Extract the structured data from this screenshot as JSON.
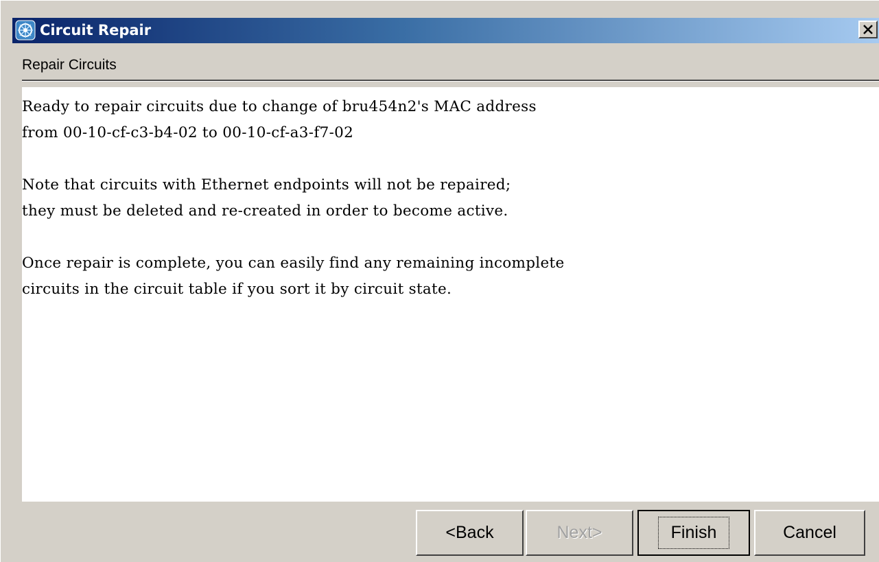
{
  "window": {
    "title": "Circuit Repair",
    "icon": "circuit-app-icon",
    "close_icon": "close-icon"
  },
  "header": {
    "label": "Repair Circuits"
  },
  "content": {
    "lines": [
      "Ready to repair circuits due to change of bru454n2's MAC address",
      "from 00-10-cf-c3-b4-02 to 00-10-cf-a3-f7-02",
      "",
      "Note that circuits with Ethernet endpoints will not be repaired;",
      "they must be deleted and re-created in order to become active.",
      "",
      "Once repair is complete, you can easily find any remaining incomplete",
      "circuits in the circuit table if you sort it by circuit state."
    ]
  },
  "buttons": {
    "back": "<Back",
    "next": "Next>",
    "finish": "Finish",
    "cancel": "Cancel"
  },
  "colors": {
    "titlebar_start": "#0a246a",
    "titlebar_end": "#a6caf0",
    "window_bg": "#d4d0c8",
    "content_bg": "#ffffff"
  }
}
